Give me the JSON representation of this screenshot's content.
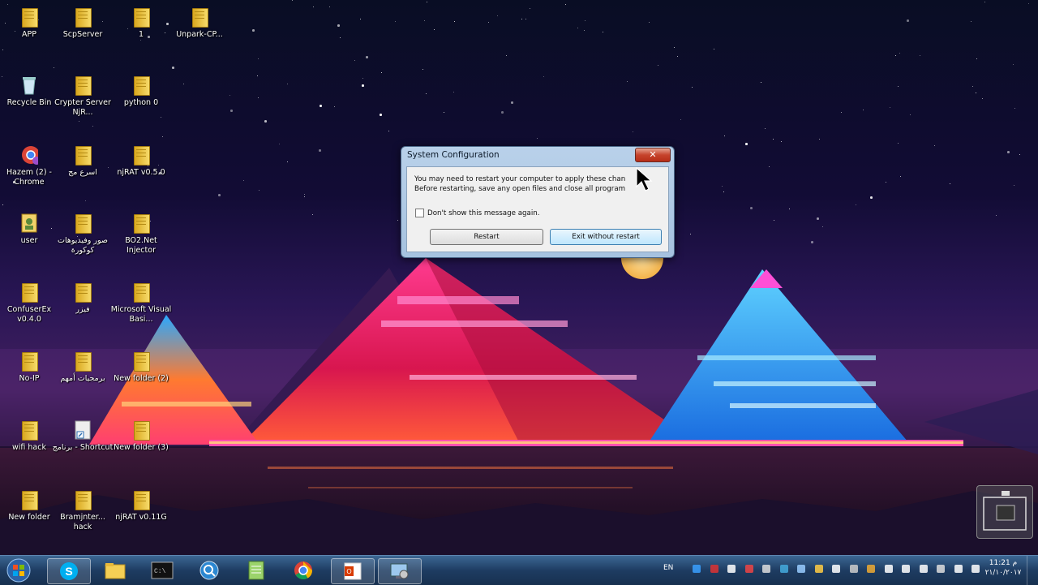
{
  "desktop": {
    "icons": [
      {
        "label": "APP",
        "type": "folder"
      },
      {
        "label": "ScpServer",
        "type": "folder"
      },
      {
        "label": "1",
        "type": "folder"
      },
      {
        "label": "Unpark-CP...",
        "type": "folder"
      },
      {
        "label": "Recycle Bin",
        "type": "recycle-bin"
      },
      {
        "label": "Crypter Server NjR...",
        "type": "folder"
      },
      {
        "label": "python 0",
        "type": "folder"
      },
      {
        "label": "Hazem (2) - Chrome",
        "type": "chrome-shortcut"
      },
      {
        "label": "اسرع مج",
        "type": "folder"
      },
      {
        "label": "njRAT v0.5.0",
        "type": "folder"
      },
      {
        "label": "user",
        "type": "user-folder"
      },
      {
        "label": "صور وفيديوهات كوكورة",
        "type": "folder"
      },
      {
        "label": "BO2.Net Injector",
        "type": "folder"
      },
      {
        "label": "ConfuserEx v0.4.0",
        "type": "folder"
      },
      {
        "label": "فيزر",
        "type": "folder"
      },
      {
        "label": "Microsoft Visual Basi...",
        "type": "folder"
      },
      {
        "label": "No-IP",
        "type": "folder"
      },
      {
        "label": "برمجيات أمهم",
        "type": "folder"
      },
      {
        "label": "New folder (2)",
        "type": "folder"
      },
      {
        "label": "wifi hack",
        "type": "folder"
      },
      {
        "label": "برنامج - Shortcut",
        "type": "shortcut"
      },
      {
        "label": "New folder (3)",
        "type": "folder"
      },
      {
        "label": "New folder",
        "type": "folder"
      },
      {
        "label": "Bramjnter... hack",
        "type": "folder"
      },
      {
        "label": "njRAT v0.11G",
        "type": "folder"
      }
    ]
  },
  "dialog": {
    "title": "System Configuration",
    "close_label": "✕",
    "message_line1": "You may need to restart your computer to apply these chan",
    "message_line2": "Before restarting, save any open files and close all program",
    "checkbox_label": "Don't show this message again.",
    "checkbox_checked": false,
    "restart_label": "Restart",
    "exit_label": "Exit without restart"
  },
  "taskbar": {
    "apps": [
      "start-orb-icon",
      "skype-icon",
      "file-explorer-icon",
      "cmd-icon",
      "search-app-icon",
      "notepad-icon",
      "chrome-icon",
      "office-icon",
      "msconfig-icon"
    ],
    "language": "EN",
    "clock_time": "11:21 م",
    "clock_date": "٢١/١٠/٢٠١٧"
  },
  "colors": {
    "taskbar": "#1e3c62",
    "dialog_frame": "#b9d1ea",
    "close_button": "#c6432c"
  }
}
